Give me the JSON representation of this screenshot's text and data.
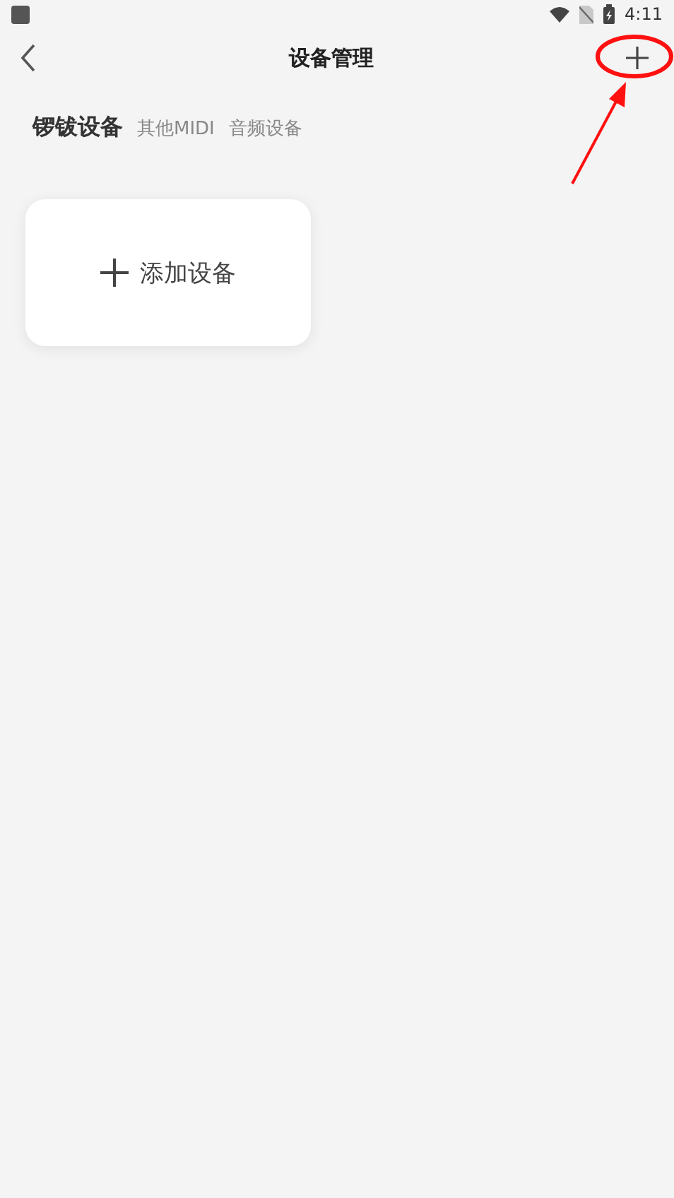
{
  "status_bar": {
    "time": "4:11"
  },
  "header": {
    "title": "设备管理"
  },
  "tabs": [
    {
      "label": "锣钹设备",
      "selected": true
    },
    {
      "label": "其他MIDI",
      "selected": false
    },
    {
      "label": "音频设备",
      "selected": false
    }
  ],
  "add_card": {
    "label": "添加设备"
  }
}
